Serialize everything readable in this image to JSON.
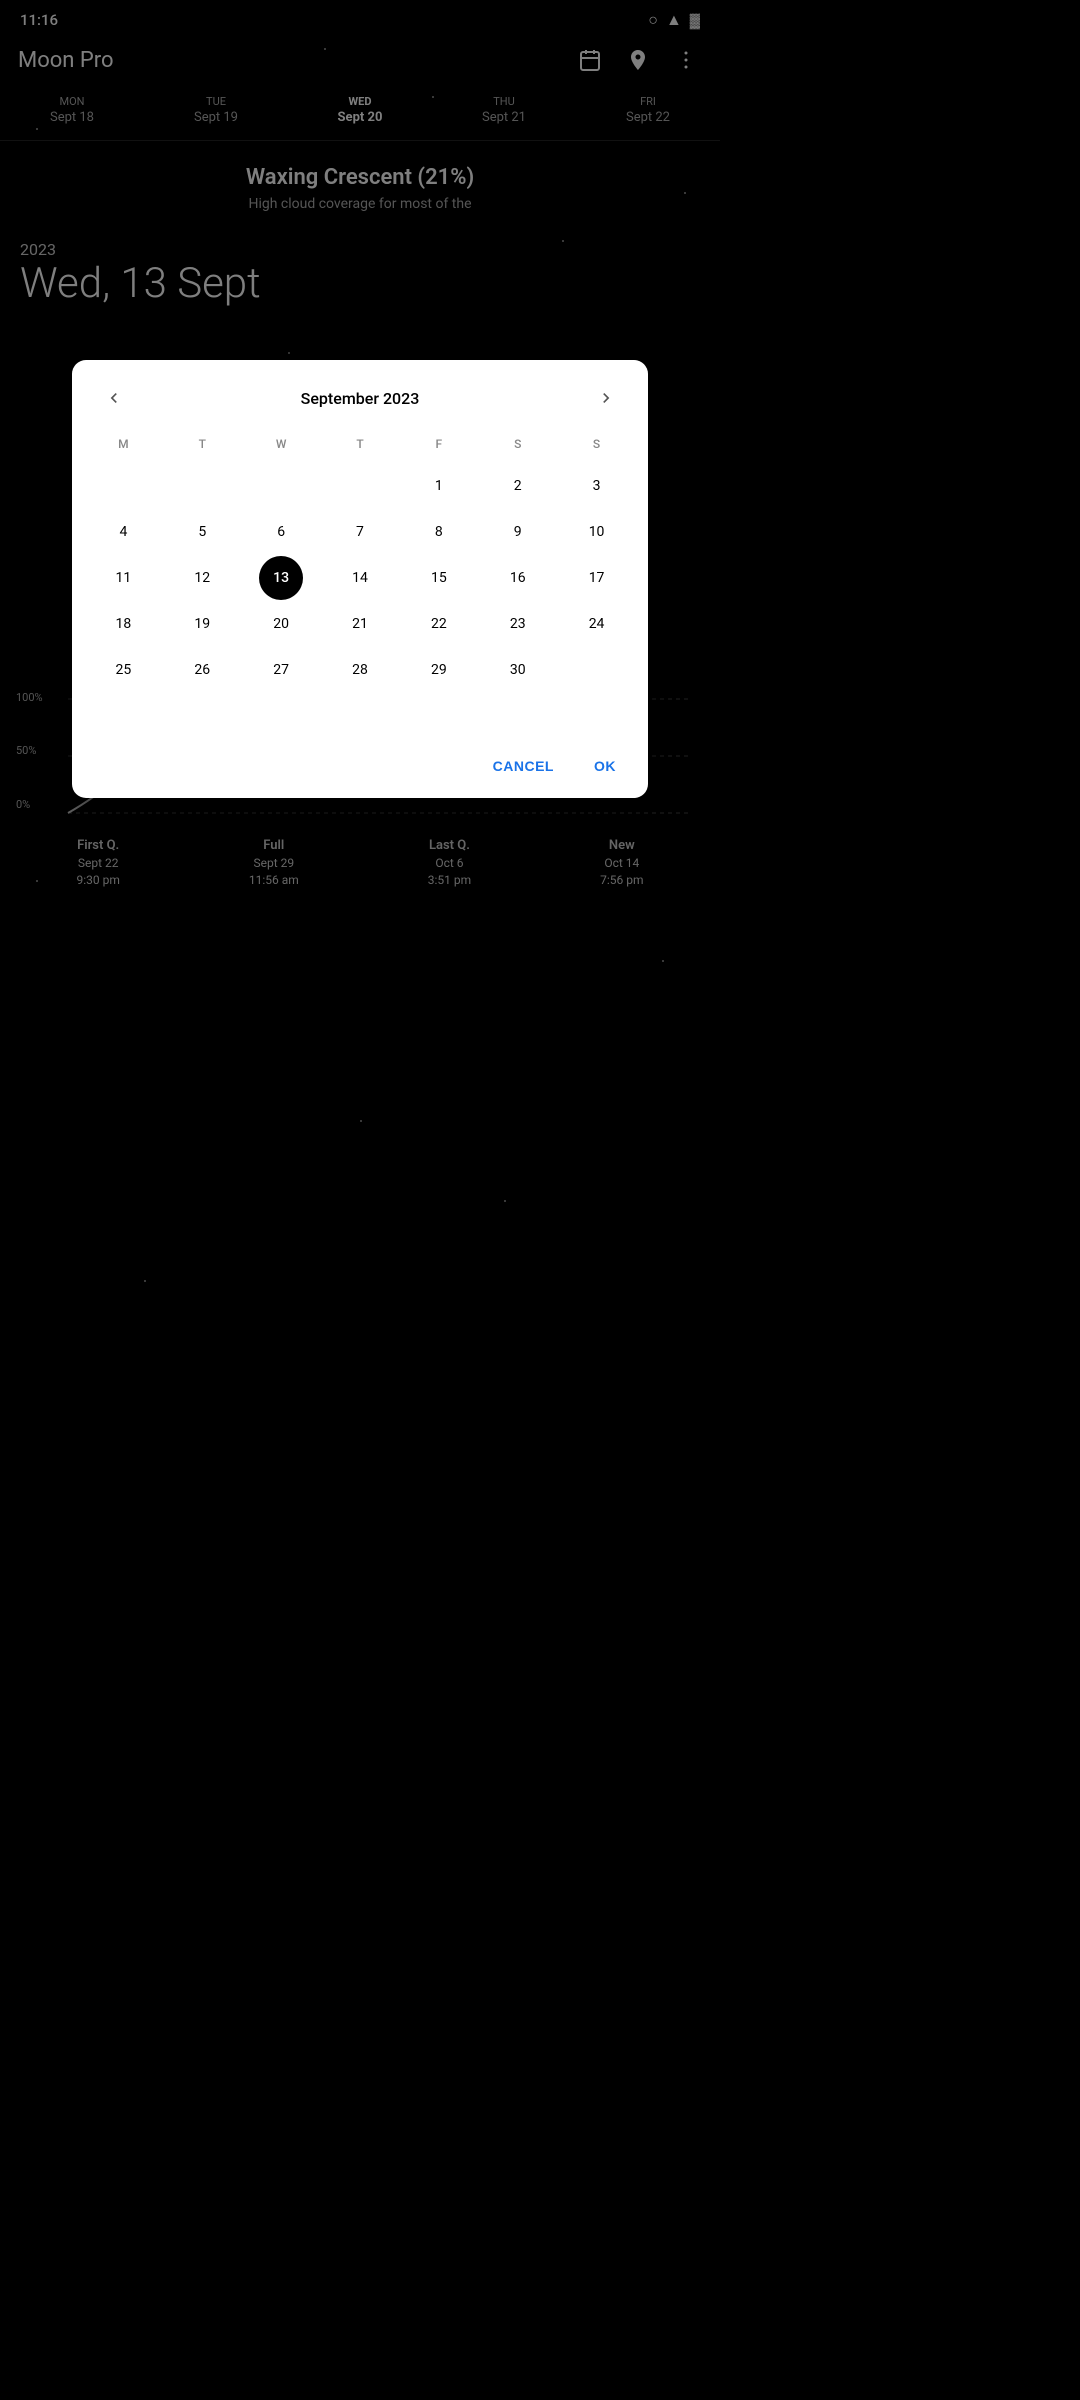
{
  "status_bar": {
    "time": "11:16"
  },
  "app_bar": {
    "title": "Moon Pro",
    "calendar_icon": "📅",
    "location_icon": "📍",
    "more_icon": "⋮"
  },
  "week_strip": {
    "days": [
      {
        "name": "MON",
        "date": "Sept 18",
        "selected": false
      },
      {
        "name": "TUE",
        "date": "Sept 19",
        "selected": false
      },
      {
        "name": "WED",
        "date": "Sept 20",
        "selected": true
      },
      {
        "name": "THU",
        "date": "Sept 21",
        "selected": false
      },
      {
        "name": "FRI",
        "date": "Sept 22",
        "selected": false
      }
    ]
  },
  "moon_info": {
    "phase": "Waxing Crescent (21%)",
    "description": "High cloud coverage for most of the"
  },
  "date_header": {
    "year": "2023",
    "full_date": "Wed, 13 Sept"
  },
  "dialog": {
    "month_title": "September 2023",
    "day_headers": [
      "M",
      "T",
      "W",
      "T",
      "F",
      "S",
      "S"
    ],
    "weeks": [
      [
        "",
        "",
        "",
        "",
        "1",
        "2",
        "3"
      ],
      [
        "4",
        "5",
        "6",
        "7",
        "8",
        "9",
        "10"
      ],
      [
        "11",
        "12",
        "13",
        "14",
        "15",
        "16",
        "17"
      ],
      [
        "18",
        "19",
        "20",
        "21",
        "22",
        "23",
        "24"
      ],
      [
        "25",
        "26",
        "27",
        "28",
        "29",
        "30",
        ""
      ]
    ],
    "selected_day": "13",
    "cancel_label": "CANCEL",
    "ok_label": "OK"
  },
  "chart": {
    "y_labels": [
      "100%",
      "50%",
      "0%"
    ],
    "phases": [
      {
        "name": "First Q.",
        "date": "Sept 22",
        "time": "9:30 pm"
      },
      {
        "name": "Full",
        "date": "Sept 29",
        "time": "11:56 am"
      },
      {
        "name": "Last Q.",
        "date": "Oct 6",
        "time": "3:51 pm"
      },
      {
        "name": "New",
        "date": "Oct 14",
        "time": "7:56 pm"
      }
    ]
  }
}
